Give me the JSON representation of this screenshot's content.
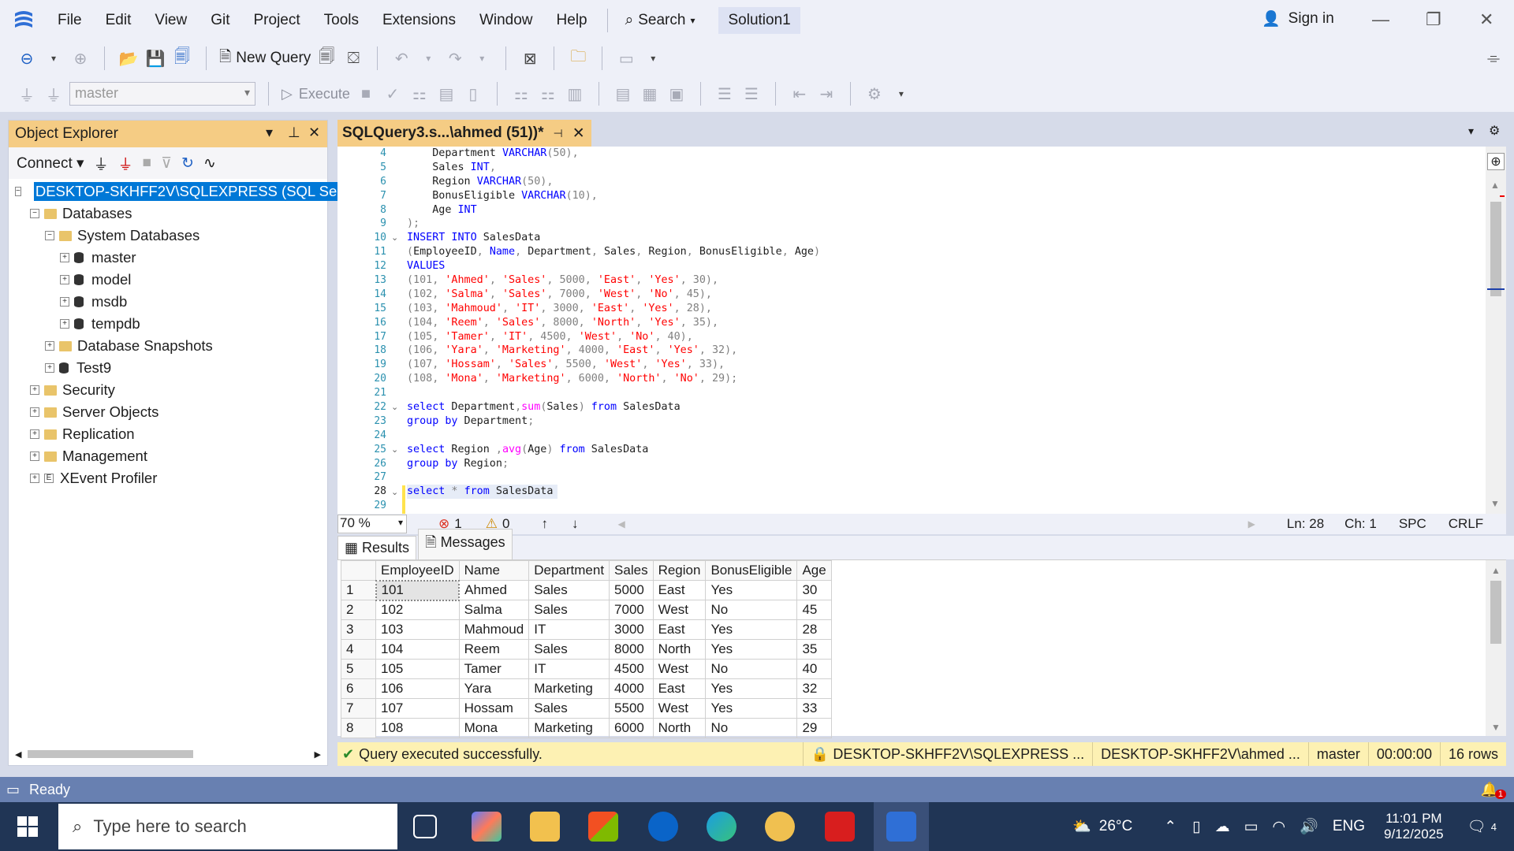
{
  "menu": {
    "items": [
      "File",
      "Edit",
      "View",
      "Git",
      "Project",
      "Tools",
      "Extensions",
      "Window",
      "Help"
    ],
    "search_label": "Search",
    "solution": "Solution1",
    "signin": "Sign in"
  },
  "toolbar": {
    "new_query": "New Query",
    "db_selector": "master",
    "execute": "Execute"
  },
  "object_explorer": {
    "title": "Object Explorer",
    "connect": "Connect",
    "nodes": [
      {
        "label": "DESKTOP-SKHFF2V\\SQLEXPRESS (SQL Server",
        "level": 0,
        "icon": "server-icon",
        "exp": "-"
      },
      {
        "label": "Databases",
        "level": 1,
        "icon": "folder-icon",
        "exp": "-"
      },
      {
        "label": "System Databases",
        "level": 2,
        "icon": "folder-icon",
        "exp": "-"
      },
      {
        "label": "master",
        "level": 3,
        "icon": "database-icon",
        "exp": "+"
      },
      {
        "label": "model",
        "level": 3,
        "icon": "database-icon",
        "exp": "+"
      },
      {
        "label": "msdb",
        "level": 3,
        "icon": "database-icon",
        "exp": "+"
      },
      {
        "label": "tempdb",
        "level": 3,
        "icon": "database-icon",
        "exp": "+"
      },
      {
        "label": "Database Snapshots",
        "level": 2,
        "icon": "folder-icon",
        "exp": "+"
      },
      {
        "label": "Test9",
        "level": 2,
        "icon": "database-icon",
        "exp": "+"
      },
      {
        "label": "Security",
        "level": 1,
        "icon": "folder-icon",
        "exp": "+"
      },
      {
        "label": "Server Objects",
        "level": 1,
        "icon": "folder-icon",
        "exp": "+"
      },
      {
        "label": "Replication",
        "level": 1,
        "icon": "folder-icon",
        "exp": "+"
      },
      {
        "label": "Management",
        "level": 1,
        "icon": "folder-icon",
        "exp": "+"
      },
      {
        "label": "XEvent Profiler",
        "level": 1,
        "icon": "xevent-icon",
        "exp": "+"
      }
    ]
  },
  "editor": {
    "tab_title": "SQLQuery3.s...\\ahmed (51))*",
    "lines": [
      {
        "n": "4",
        "fold": "",
        "parts": [
          [
            "    Department ",
            ""
          ],
          [
            "VARCHAR",
            "kw"
          ],
          [
            "(50),",
            "gy"
          ]
        ]
      },
      {
        "n": "5",
        "fold": "",
        "parts": [
          [
            "    Sales ",
            ""
          ],
          [
            "INT",
            "kw"
          ],
          [
            ",",
            "gy"
          ]
        ]
      },
      {
        "n": "6",
        "fold": "",
        "parts": [
          [
            "    Region ",
            ""
          ],
          [
            "VARCHAR",
            "kw"
          ],
          [
            "(50),",
            "gy"
          ]
        ]
      },
      {
        "n": "7",
        "fold": "",
        "parts": [
          [
            "    BonusEligible ",
            ""
          ],
          [
            "VARCHAR",
            "kw"
          ],
          [
            "(10),",
            "gy"
          ]
        ]
      },
      {
        "n": "8",
        "fold": "",
        "parts": [
          [
            "    Age ",
            ""
          ],
          [
            "INT",
            "kw"
          ]
        ]
      },
      {
        "n": "9",
        "fold": "",
        "parts": [
          [
            ");",
            "gy"
          ]
        ]
      },
      {
        "n": "10",
        "fold": "v",
        "parts": [
          [
            "INSERT INTO",
            "kw"
          ],
          [
            " SalesData",
            ""
          ]
        ]
      },
      {
        "n": "11",
        "fold": "",
        "parts": [
          [
            "(",
            "gy"
          ],
          [
            "EmployeeID",
            ""
          ],
          [
            ", ",
            "gy"
          ],
          [
            "Name",
            "kw"
          ],
          [
            ", ",
            "gy"
          ],
          [
            "Department",
            ""
          ],
          [
            ", ",
            "gy"
          ],
          [
            "Sales",
            ""
          ],
          [
            ", ",
            "gy"
          ],
          [
            "Region",
            ""
          ],
          [
            ", ",
            "gy"
          ],
          [
            "BonusEligible",
            ""
          ],
          [
            ", ",
            "gy"
          ],
          [
            "Age",
            ""
          ],
          [
            ")",
            "gy"
          ]
        ]
      },
      {
        "n": "12",
        "fold": "",
        "parts": [
          [
            "VALUES",
            "kw"
          ]
        ]
      },
      {
        "n": "13",
        "fold": "",
        "parts": [
          [
            "(101, ",
            "gy"
          ],
          [
            "'Ahmed'",
            "st"
          ],
          [
            ", ",
            "gy"
          ],
          [
            "'Sales'",
            "st"
          ],
          [
            ", 5000, ",
            "gy"
          ],
          [
            "'East'",
            "st"
          ],
          [
            ", ",
            "gy"
          ],
          [
            "'Yes'",
            "st"
          ],
          [
            ", 30),",
            "gy"
          ]
        ]
      },
      {
        "n": "14",
        "fold": "",
        "parts": [
          [
            "(102, ",
            "gy"
          ],
          [
            "'Salma'",
            "st"
          ],
          [
            ", ",
            "gy"
          ],
          [
            "'Sales'",
            "st"
          ],
          [
            ", 7000, ",
            "gy"
          ],
          [
            "'West'",
            "st"
          ],
          [
            ", ",
            "gy"
          ],
          [
            "'No'",
            "st"
          ],
          [
            ", 45),",
            "gy"
          ]
        ]
      },
      {
        "n": "15",
        "fold": "",
        "parts": [
          [
            "(103, ",
            "gy"
          ],
          [
            "'Mahmoud'",
            "st"
          ],
          [
            ", ",
            "gy"
          ],
          [
            "'IT'",
            "st"
          ],
          [
            ", 3000, ",
            "gy"
          ],
          [
            "'East'",
            "st"
          ],
          [
            ", ",
            "gy"
          ],
          [
            "'Yes'",
            "st"
          ],
          [
            ", 28),",
            "gy"
          ]
        ]
      },
      {
        "n": "16",
        "fold": "",
        "parts": [
          [
            "(104, ",
            "gy"
          ],
          [
            "'Reem'",
            "st"
          ],
          [
            ", ",
            "gy"
          ],
          [
            "'Sales'",
            "st"
          ],
          [
            ", 8000, ",
            "gy"
          ],
          [
            "'North'",
            "st"
          ],
          [
            ", ",
            "gy"
          ],
          [
            "'Yes'",
            "st"
          ],
          [
            ", 35),",
            "gy"
          ]
        ]
      },
      {
        "n": "17",
        "fold": "",
        "parts": [
          [
            "(105, ",
            "gy"
          ],
          [
            "'Tamer'",
            "st"
          ],
          [
            ", ",
            "gy"
          ],
          [
            "'IT'",
            "st"
          ],
          [
            ", 4500, ",
            "gy"
          ],
          [
            "'West'",
            "st"
          ],
          [
            ", ",
            "gy"
          ],
          [
            "'No'",
            "st"
          ],
          [
            ", 40),",
            "gy"
          ]
        ]
      },
      {
        "n": "18",
        "fold": "",
        "parts": [
          [
            "(106, ",
            "gy"
          ],
          [
            "'Yara'",
            "st"
          ],
          [
            ", ",
            "gy"
          ],
          [
            "'Marketing'",
            "st"
          ],
          [
            ", 4000, ",
            "gy"
          ],
          [
            "'East'",
            "st"
          ],
          [
            ", ",
            "gy"
          ],
          [
            "'Yes'",
            "st"
          ],
          [
            ", 32),",
            "gy"
          ]
        ]
      },
      {
        "n": "19",
        "fold": "",
        "parts": [
          [
            "(107, ",
            "gy"
          ],
          [
            "'Hossam'",
            "st"
          ],
          [
            ", ",
            "gy"
          ],
          [
            "'Sales'",
            "st"
          ],
          [
            ", 5500, ",
            "gy"
          ],
          [
            "'West'",
            "st"
          ],
          [
            ", ",
            "gy"
          ],
          [
            "'Yes'",
            "st"
          ],
          [
            ", 33),",
            "gy"
          ]
        ]
      },
      {
        "n": "20",
        "fold": "",
        "parts": [
          [
            "(108, ",
            "gy"
          ],
          [
            "'Mona'",
            "st"
          ],
          [
            ", ",
            "gy"
          ],
          [
            "'Marketing'",
            "st"
          ],
          [
            ", 6000, ",
            "gy"
          ],
          [
            "'North'",
            "st"
          ],
          [
            ", ",
            "gy"
          ],
          [
            "'No'",
            "st"
          ],
          [
            ", 29);",
            "gy"
          ]
        ]
      },
      {
        "n": "21",
        "fold": "",
        "parts": []
      },
      {
        "n": "22",
        "fold": "v",
        "parts": [
          [
            "select",
            "kw"
          ],
          [
            " Department",
            ""
          ],
          [
            ",",
            "gy"
          ],
          [
            "sum",
            "fn"
          ],
          [
            "(",
            "gy"
          ],
          [
            "Sales",
            ""
          ],
          [
            ")",
            "gy"
          ],
          [
            " from",
            "kw"
          ],
          [
            " SalesData",
            ""
          ]
        ]
      },
      {
        "n": "23",
        "fold": "",
        "parts": [
          [
            "group by",
            "kw"
          ],
          [
            " Department",
            ""
          ],
          [
            ";",
            "gy"
          ]
        ]
      },
      {
        "n": "24",
        "fold": "",
        "parts": []
      },
      {
        "n": "25",
        "fold": "v",
        "parts": [
          [
            "select",
            "kw"
          ],
          [
            " Region ",
            ""
          ],
          [
            ",",
            "gy"
          ],
          [
            "avg",
            "fn"
          ],
          [
            "(",
            "gy"
          ],
          [
            "Age",
            ""
          ],
          [
            ")",
            "gy"
          ],
          [
            " from",
            "kw"
          ],
          [
            " SalesData",
            ""
          ]
        ]
      },
      {
        "n": "26",
        "fold": "",
        "parts": [
          [
            "group by",
            "kw"
          ],
          [
            " Region",
            ""
          ],
          [
            ";",
            "gy"
          ]
        ]
      },
      {
        "n": "27",
        "fold": "",
        "parts": []
      },
      {
        "n": "28",
        "fold": "v",
        "parts": [
          [
            "select",
            "kw"
          ],
          [
            " * ",
            "gy"
          ],
          [
            "from",
            "kw"
          ],
          [
            " SalesData",
            ""
          ]
        ]
      },
      {
        "n": "29",
        "fold": "",
        "parts": []
      }
    ],
    "zoom": "70 %",
    "errors": "1",
    "warnings": "0",
    "ln": "Ln: 28",
    "ch": "Ch: 1",
    "spc": "SPC",
    "crlf": "CRLF"
  },
  "results": {
    "tab_results": "Results",
    "tab_messages": "Messages",
    "columns": [
      "EmployeeID",
      "Name",
      "Department",
      "Sales",
      "Region",
      "BonusEligible",
      "Age"
    ],
    "rows": [
      [
        "1",
        "101",
        "Ahmed",
        "Sales",
        "5000",
        "East",
        "Yes",
        "30"
      ],
      [
        "2",
        "102",
        "Salma",
        "Sales",
        "7000",
        "West",
        "No",
        "45"
      ],
      [
        "3",
        "103",
        "Mahmoud",
        "IT",
        "3000",
        "East",
        "Yes",
        "28"
      ],
      [
        "4",
        "104",
        "Reem",
        "Sales",
        "8000",
        "North",
        "Yes",
        "35"
      ],
      [
        "5",
        "105",
        "Tamer",
        "IT",
        "4500",
        "West",
        "No",
        "40"
      ],
      [
        "6",
        "106",
        "Yara",
        "Marketing",
        "4000",
        "East",
        "Yes",
        "32"
      ],
      [
        "7",
        "107",
        "Hossam",
        "Sales",
        "5500",
        "West",
        "Yes",
        "33"
      ],
      [
        "8",
        "108",
        "Mona",
        "Marketing",
        "6000",
        "North",
        "No",
        "29"
      ]
    ]
  },
  "status": {
    "message": "Query executed successfully.",
    "server": "DESKTOP-SKHFF2V\\SQLEXPRESS ...",
    "user": "DESKTOP-SKHFF2V\\ahmed ...",
    "db": "master",
    "time": "00:00:00",
    "rows": "16 rows"
  },
  "app_status": "Ready",
  "taskbar": {
    "search_placeholder": "Type here to search",
    "temp": "26°C",
    "lang": "ENG",
    "time": "11:01 PM",
    "date": "9/12/2025",
    "notif": "4",
    "badge": "1"
  },
  "colors": {
    "accent": "#0078d7",
    "tab_gold": "#f5cc84",
    "status_yellow": "#fdf1b3",
    "ready_bar": "#6880b1",
    "taskbar": "#203555"
  }
}
